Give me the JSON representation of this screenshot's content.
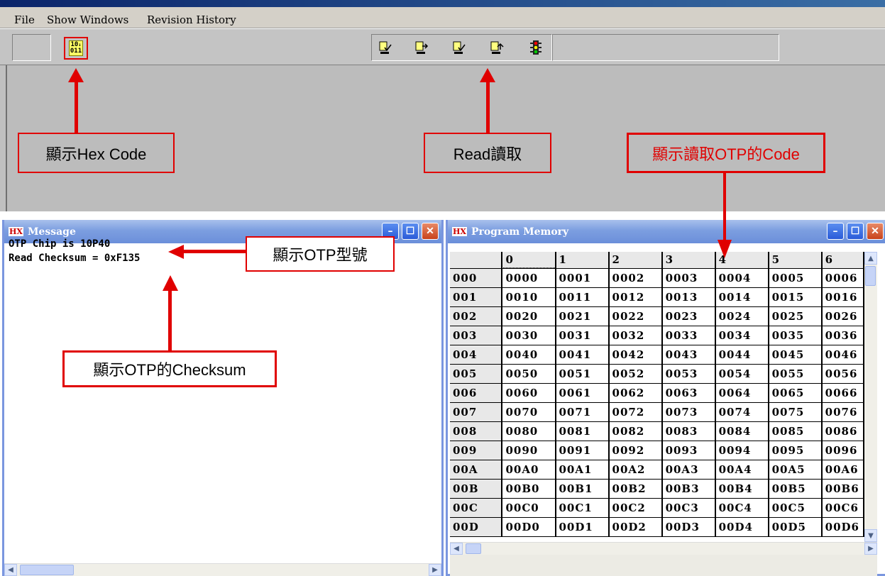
{
  "menu": {
    "file": "File",
    "show_windows": "Show Windows",
    "revision_history": "Revision History"
  },
  "toolbar": {
    "hex_button_label": "10̱\n011",
    "hex_icon": "hex-code-icon",
    "buttons": [
      "read-icon",
      "write-icon",
      "verify-icon",
      "blank-check-icon",
      "traffic-light-icon"
    ]
  },
  "callouts": {
    "hex": "顯示Hex Code",
    "read": "Read讀取",
    "otp_code": "顯示讀取OTP的Code",
    "otp_model": "顯示OTP型號",
    "checksum": "顯示OTP的Checksum"
  },
  "message_window": {
    "title": "Message",
    "lines": [
      "OTP Chip is 10P40",
      "Read Checksum = 0xF135"
    ]
  },
  "program_window": {
    "title": "Program Memory",
    "columns": [
      "0",
      "1",
      "2",
      "3",
      "4",
      "5",
      "6"
    ],
    "rows": [
      {
        "addr": "000",
        "cells": [
          "0000",
          "0001",
          "0002",
          "0003",
          "0004",
          "0005",
          "0006"
        ]
      },
      {
        "addr": "001",
        "cells": [
          "0010",
          "0011",
          "0012",
          "0013",
          "0014",
          "0015",
          "0016"
        ]
      },
      {
        "addr": "002",
        "cells": [
          "0020",
          "0021",
          "0022",
          "0023",
          "0024",
          "0025",
          "0026"
        ]
      },
      {
        "addr": "003",
        "cells": [
          "0030",
          "0031",
          "0032",
          "0033",
          "0034",
          "0035",
          "0036"
        ]
      },
      {
        "addr": "004",
        "cells": [
          "0040",
          "0041",
          "0042",
          "0043",
          "0044",
          "0045",
          "0046"
        ]
      },
      {
        "addr": "005",
        "cells": [
          "0050",
          "0051",
          "0052",
          "0053",
          "0054",
          "0055",
          "0056"
        ]
      },
      {
        "addr": "006",
        "cells": [
          "0060",
          "0061",
          "0062",
          "0063",
          "0064",
          "0065",
          "0066"
        ]
      },
      {
        "addr": "007",
        "cells": [
          "0070",
          "0071",
          "0072",
          "0073",
          "0074",
          "0075",
          "0076"
        ]
      },
      {
        "addr": "008",
        "cells": [
          "0080",
          "0081",
          "0082",
          "0083",
          "0084",
          "0085",
          "0086"
        ]
      },
      {
        "addr": "009",
        "cells": [
          "0090",
          "0091",
          "0092",
          "0093",
          "0094",
          "0095",
          "0096"
        ]
      },
      {
        "addr": "00A",
        "cells": [
          "00A0",
          "00A1",
          "00A2",
          "00A3",
          "00A4",
          "00A5",
          "00A6"
        ]
      },
      {
        "addr": "00B",
        "cells": [
          "00B0",
          "00B1",
          "00B2",
          "00B3",
          "00B4",
          "00B5",
          "00B6"
        ]
      },
      {
        "addr": "00C",
        "cells": [
          "00C0",
          "00C1",
          "00C2",
          "00C3",
          "00C4",
          "00C5",
          "00C6"
        ]
      },
      {
        "addr": "00D",
        "cells": [
          "00D0",
          "00D1",
          "00D2",
          "00D3",
          "00D4",
          "00D5",
          "00D6"
        ]
      }
    ]
  },
  "colors": {
    "callout_red": "#e00000",
    "title_blue": "#7c9ee0",
    "close_red": "#c8431c"
  }
}
